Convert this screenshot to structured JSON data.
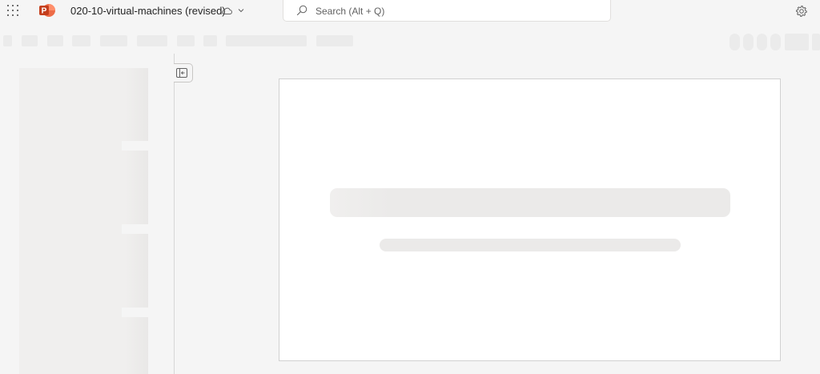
{
  "header": {
    "app_launcher_icon": "app-launcher-waffle-icon",
    "app_logo_icon": "powerpoint-logo-icon",
    "app_logo_letter": "P",
    "doc_title": "020-10-virtual-machines (revised)",
    "cloud_status_icon": "cloud-icon",
    "title_menu_icon": "chevron-down-icon",
    "search": {
      "icon": "search-icon",
      "placeholder": "Search (Alt + Q)"
    },
    "settings_icon": "gear-icon"
  },
  "ribbon": {
    "state": "loading-skeleton"
  },
  "thumbnail_pane": {
    "state": "loading-skeleton",
    "collapse_icon": "collapse-pane-icon"
  },
  "slide": {
    "state": "loading-skeleton",
    "background": "#ffffff"
  },
  "colors": {
    "brand_powerpoint": "#c43e1c",
    "chrome_background": "#f5f5f5",
    "skeleton": "#ebebeb"
  }
}
